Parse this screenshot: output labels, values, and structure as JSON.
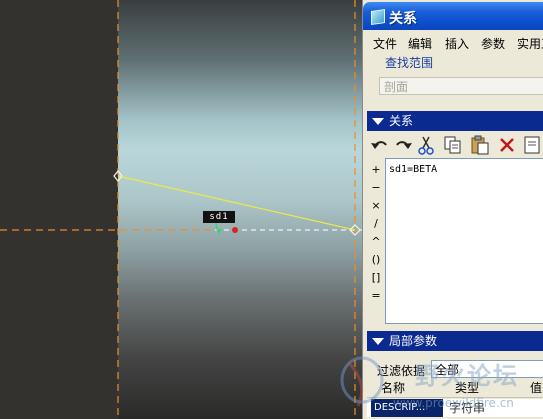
{
  "viewport": {
    "dimension_tag": "sd1",
    "colors": {
      "sketch_line": "#e8e84a",
      "centerline": "#e8902a",
      "marker": "#e02020",
      "dimension": "#3fd07a"
    }
  },
  "dialog": {
    "title": "关系",
    "menu": [
      "文件",
      "编辑",
      "插入",
      "参数",
      "实用工"
    ],
    "find_scope_label": "查找范围",
    "find_scope_value": "剖面",
    "relations_section_label": "关系",
    "toolbar_buttons": [
      "undo-icon",
      "redo-icon",
      "cut-icon",
      "copy-icon",
      "paste-icon",
      "delete-icon",
      "edit-icon"
    ],
    "operators": [
      "+",
      "−",
      "×",
      "/",
      "^",
      "()",
      "[]",
      "="
    ],
    "relation_text": "sd1=BETA",
    "local_params_label": "局部参数",
    "filter_label": "过滤依据",
    "filter_value": "全部",
    "columns": {
      "name": "名称",
      "type": "类型",
      "value": "值"
    },
    "rows": [
      {
        "name": "DESCRIP...",
        "type": "字符串"
      }
    ]
  },
  "watermark": {
    "text": "野火论坛",
    "url": "www.proewildfire.cn"
  }
}
